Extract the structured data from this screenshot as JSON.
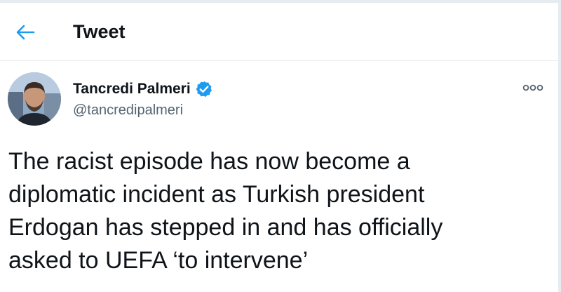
{
  "header": {
    "title": "Tweet",
    "back_icon": "arrow-left-icon"
  },
  "tweet": {
    "author": {
      "display_name": "Tancredi Palmeri",
      "handle": "@tancredipalmeri",
      "verified": true,
      "verified_icon": "verified-badge-icon",
      "avatar_icon": "user-avatar"
    },
    "more_icon": "more-options-icon",
    "text": "The racist episode has now become a\ndiplomatic incident as Turkish president\nErdogan has stepped in and has officially\nasked to UEFA ‘to intervene’"
  },
  "colors": {
    "accent": "#1d9bf0",
    "text": "#0f1419",
    "secondary_text": "#536471",
    "border": "#e6ecf0"
  }
}
